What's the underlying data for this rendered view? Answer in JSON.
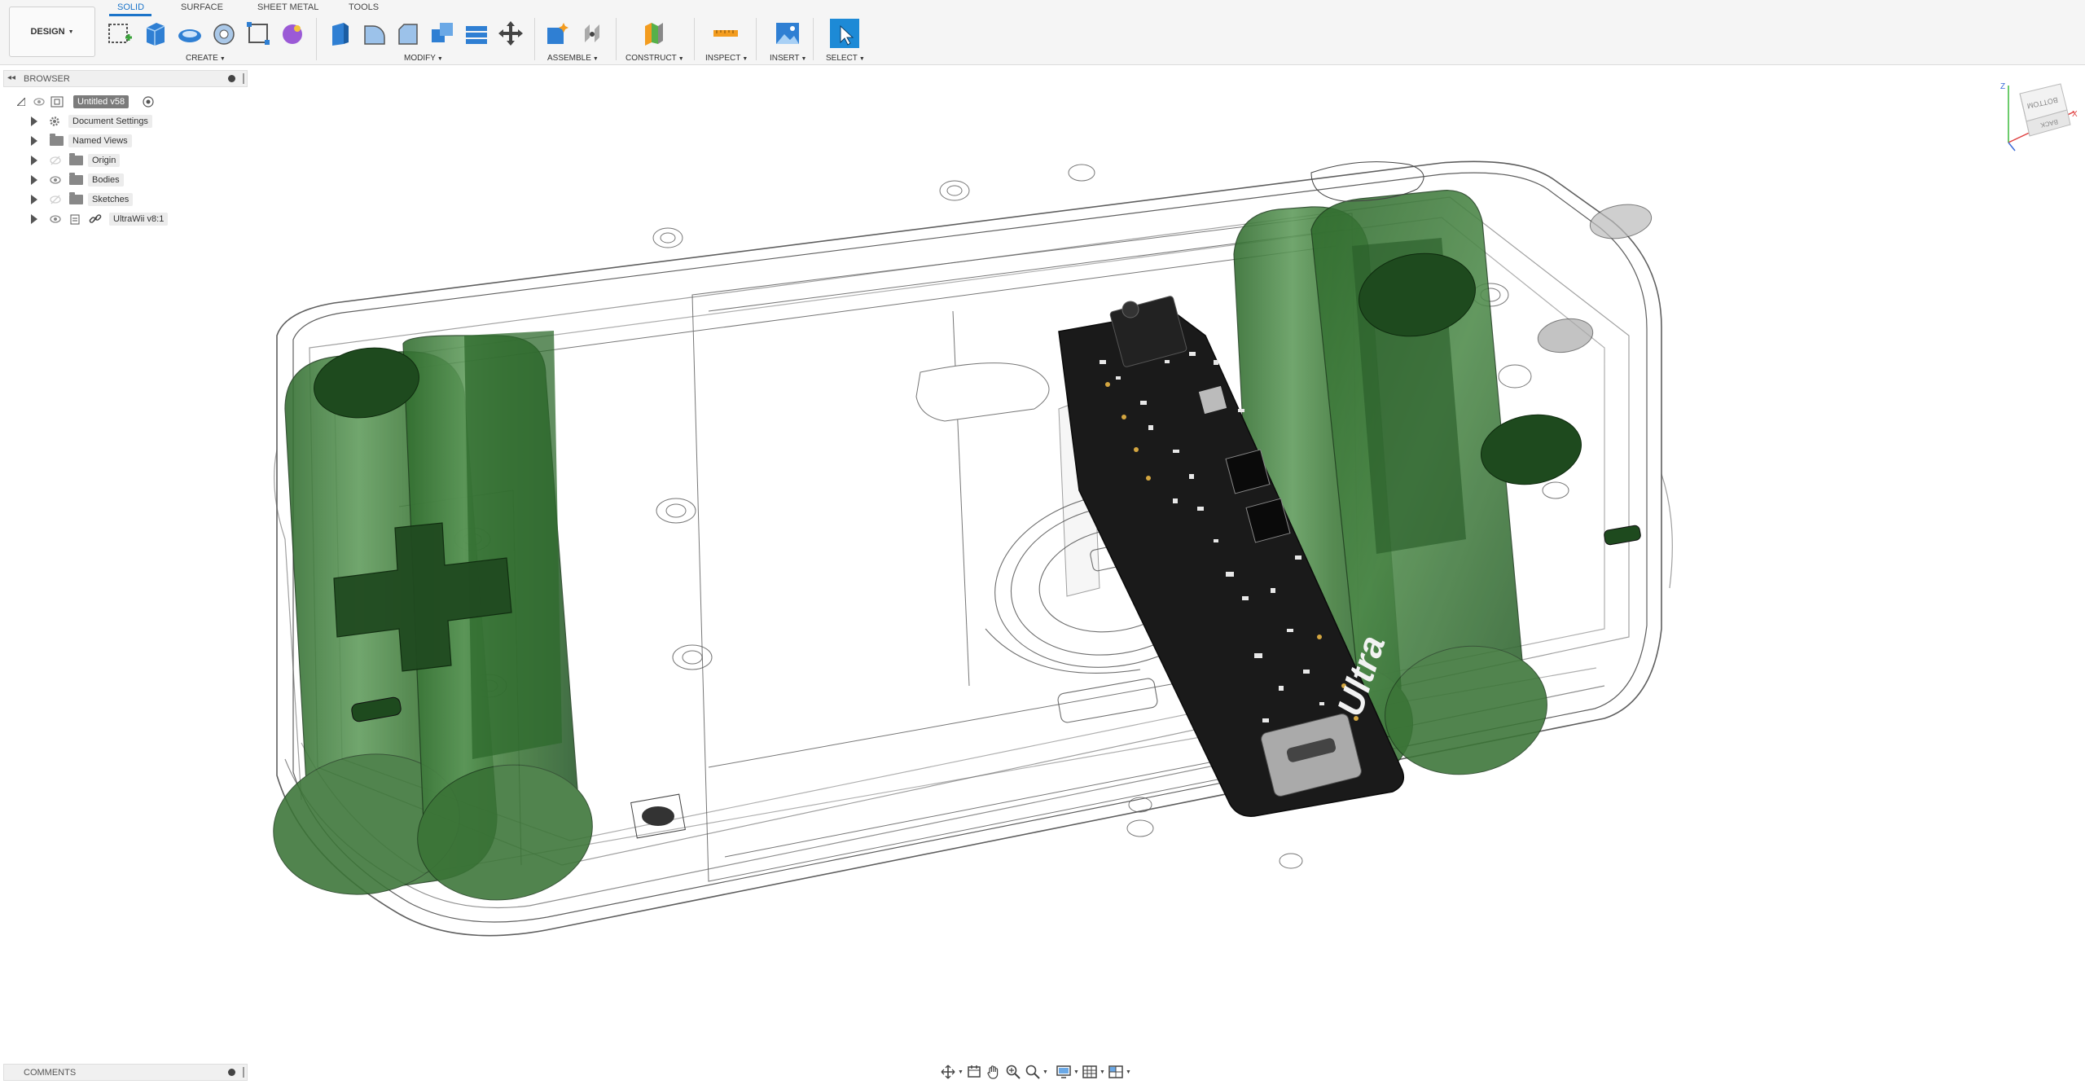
{
  "workspace": {
    "label": "DESIGN"
  },
  "tabs": [
    {
      "label": "SOLID",
      "active": true
    },
    {
      "label": "SURFACE"
    },
    {
      "label": "SHEET METAL"
    },
    {
      "label": "TOOLS"
    }
  ],
  "groups": {
    "create": "CREATE",
    "modify": "MODIFY",
    "assemble": "ASSEMBLE",
    "construct": "CONSTRUCT",
    "inspect": "INSPECT",
    "insert": "INSERT",
    "select": "SELECT"
  },
  "browser": {
    "title": "BROWSER",
    "root": "Untitled v58",
    "items": [
      {
        "label": "Document Settings",
        "icon": "gear-icon"
      },
      {
        "label": "Named Views",
        "icon": "folder-icon"
      },
      {
        "label": "Origin",
        "icon": "folder-icon",
        "visible": false
      },
      {
        "label": "Bodies",
        "icon": "folder-icon",
        "visible": true
      },
      {
        "label": "Sketches",
        "icon": "folder-icon",
        "visible": false
      },
      {
        "label": "UltraWii v8:1",
        "icon": "component-link-icon",
        "visible": true
      }
    ]
  },
  "comments": {
    "title": "COMMENTS"
  },
  "viewcube": {
    "face_top": "BOTTOM",
    "face_side": "BACK",
    "axis_z": "Z",
    "axis_x": "X"
  },
  "board": {
    "silkscreen": "Ultra"
  },
  "colors": {
    "accent": "#1b74c9",
    "battery_green": "#3f7a3a",
    "pcb_black": "#1a1a1a"
  }
}
